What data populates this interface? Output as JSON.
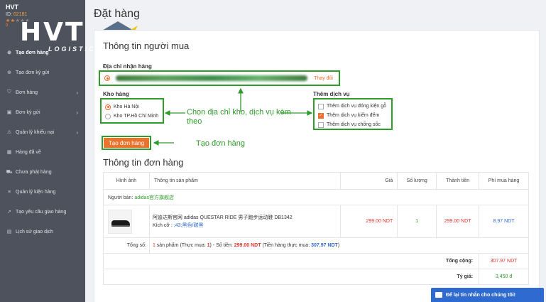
{
  "sidebar": {
    "user_name": "HVT",
    "user_id_label": "ID:",
    "user_id_value": "02181",
    "rating_value": "0",
    "items": [
      {
        "label": "Tạo đơn hàng"
      },
      {
        "label": "Tạo đơn ký gửi"
      },
      {
        "label": "Đơn hàng"
      },
      {
        "label": "Đơn ký gửi"
      },
      {
        "label": "Quản lý khiếu nại"
      },
      {
        "label": "Hàng đã về"
      },
      {
        "label": "Chưa phát hàng"
      },
      {
        "label": "Quản lý kiện hàng"
      },
      {
        "label": "Tạo yêu cầu giao hàng"
      },
      {
        "label": "Lịch sử giao dịch"
      }
    ]
  },
  "logo": {
    "main": "HVT",
    "sub": "LOGISTICS"
  },
  "page": {
    "title": "Đặt hàng"
  },
  "buyer": {
    "section_title": "Thông tin người mua",
    "address_label": "Địa chỉ nhận hàng",
    "change_label": "Thay đổi",
    "warehouse_label": "Kho hàng",
    "warehouses": [
      "Kho Hà Nội",
      "Kho TP.Hồ Chí Minh"
    ],
    "services_label": "Thêm dịch vụ",
    "services": [
      "Thêm dịch vụ đóng kiện gỗ",
      "Thêm dịch vụ kiểm đếm",
      "Thêm dịch vụ chống sốc"
    ],
    "create_button": "Tạo đơn hàng"
  },
  "annotations": {
    "choose": "Chọn địa chỉ kho, dịch vụ kèm theo",
    "create": "Tạo đơn hàng"
  },
  "order": {
    "section_title": "Thông tin đơn hàng",
    "columns": [
      "Hình ảnh",
      "Thông tin sản phẩm",
      "Giá",
      "Số lượng",
      "Thành tiền",
      "Phí mua hàng"
    ],
    "seller_label": "Người bán:",
    "seller_value": "adidas官方旗舰店",
    "product_name": "阿迪达斯官网 adidas QUESTAR RIDE 男子跑步运动鞋 DB1342",
    "size_label": "Kích cỡ :",
    "size_value": ";43;黑色/碳黑",
    "price": "299.00 NDT",
    "quantity": "1",
    "subtotal": "299.00 NDT",
    "fee": "8.97 NDT",
    "total_label": "Tổng số:",
    "total_qty": "1",
    "total_text1": " sản phẩm (Thực mua: ",
    "total_real_qty": "1",
    "total_text2": ") - Số tiền: ",
    "total_money": "299.00 NDT",
    "total_text3": " (Tiền hàng thực mua: ",
    "total_real_money": "307.97 NDT",
    "total_text4": ")",
    "grand_label": "Tổng cộng:",
    "grand_value": "307.97 NDT",
    "rate_label": "Tỷ giá:",
    "rate_value": "3,450 đ"
  },
  "chat": {
    "label": "Để lại tin nhắn cho chúng tôi!"
  },
  "colors": {
    "accent": "#e8732f",
    "highlight": "#2e9c2a",
    "sidebar": "#4d525c"
  }
}
